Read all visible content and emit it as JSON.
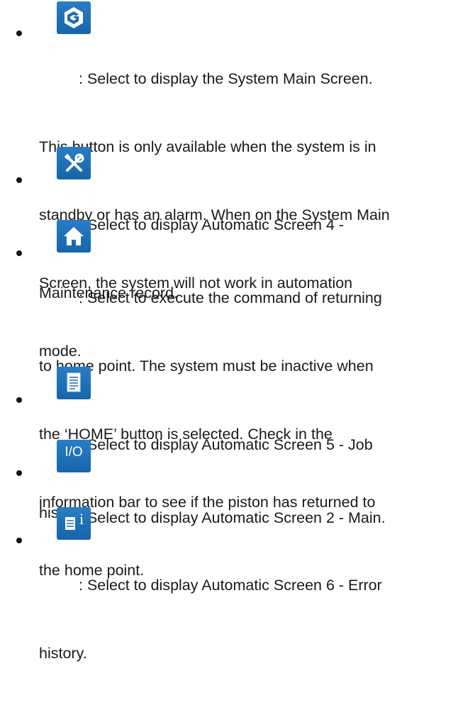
{
  "items": [
    {
      "icon": "graco-logo-icon",
      "lines": [
        ": Select to display the System Main Screen.",
        "This button is only available when the system is in",
        "standby or has an alarm. When on the System Main",
        "Screen, the system will not work in automation",
        "mode."
      ]
    },
    {
      "icon": "wrench-screwdriver-icon",
      "lines": [
        ": Select to display Automatic Screen 4 -",
        "Maintenance record."
      ]
    },
    {
      "icon": "home-icon",
      "lines": [
        ": Select to execute the command of returning",
        "to home point. The system must be inactive when",
        "the ‘HOME’ button is selected. Check in the",
        "information bar to see if the piston has returned to",
        "the home point."
      ]
    },
    {
      "icon": "document-icon",
      "lines": [
        ": Select to display Automatic Screen 5 - Job",
        "history."
      ]
    },
    {
      "icon": "io-icon",
      "icon_text": "I/O",
      "lines": [
        ": Select to display Automatic Screen 2 - Main."
      ]
    },
    {
      "icon": "document-info-icon",
      "icon_text": "i",
      "lines": [
        ": Select to display Automatic Screen 6 - Error",
        "history."
      ]
    }
  ]
}
